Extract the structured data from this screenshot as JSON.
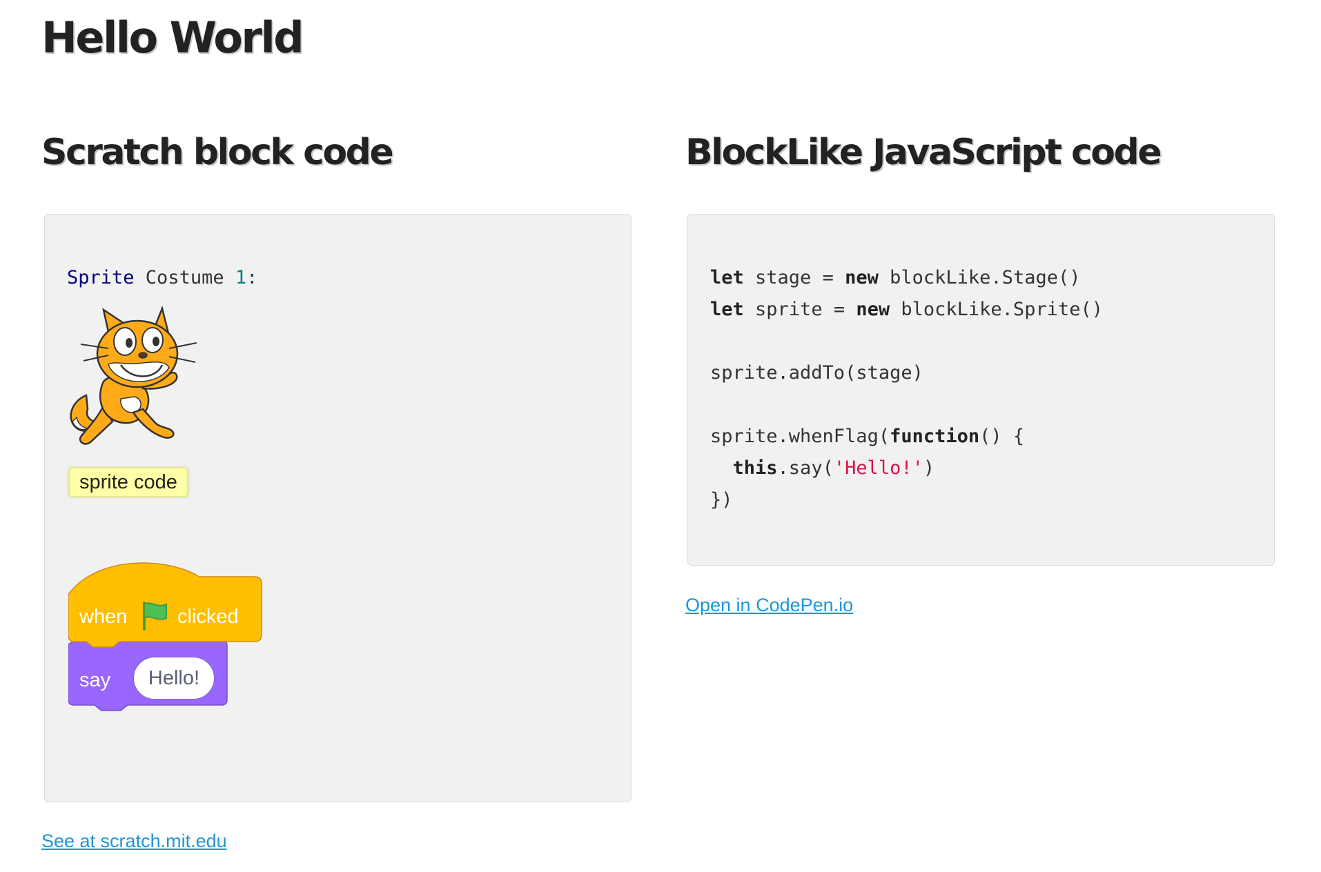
{
  "page": {
    "title": "Hello World"
  },
  "scratch_section": {
    "heading": "Scratch block code",
    "costume_line": {
      "keyword": "Sprite",
      "label": " Costume ",
      "number": "1",
      "suffix": ":"
    },
    "sprite_image": "scratch-cat-icon",
    "badge_label": "sprite code",
    "blocks": {
      "hat_block": {
        "word_before": "when",
        "icon": "green-flag-icon",
        "word_after": "clicked",
        "color": "#ffbf26"
      },
      "say_block": {
        "word": "say",
        "value": "Hello!",
        "color": "#9966ff"
      }
    },
    "link_label": "See at scratch.mit.edu"
  },
  "blocklike_section": {
    "heading": "BlockLike JavaScript code",
    "code": {
      "line1_kw1": "let",
      "line1_mid": " stage = ",
      "line1_kw2": "new",
      "line1_end": " blockLike.Stage()",
      "line2_kw1": "let",
      "line2_mid": " sprite = ",
      "line2_kw2": "new",
      "line2_end": " blockLike.Sprite()",
      "line3": "sprite.addTo(stage)",
      "line4_start": "sprite.whenFlag(",
      "line4_kw": "function",
      "line4_end": "() {",
      "line5_indent": "  ",
      "line5_kw": "this",
      "line5_mid": ".say(",
      "line5_str": "'Hello!'",
      "line5_end": ")",
      "line6": "})"
    },
    "link_label": "Open in CodePen.io"
  },
  "colors": {
    "link": "#1b96d6",
    "panel_bg": "#f1f1f1",
    "string_literal": "#dd1144",
    "sprite_keyword": "#000080",
    "number_literal": "#008080",
    "badge_bg": "#ffffa8"
  }
}
